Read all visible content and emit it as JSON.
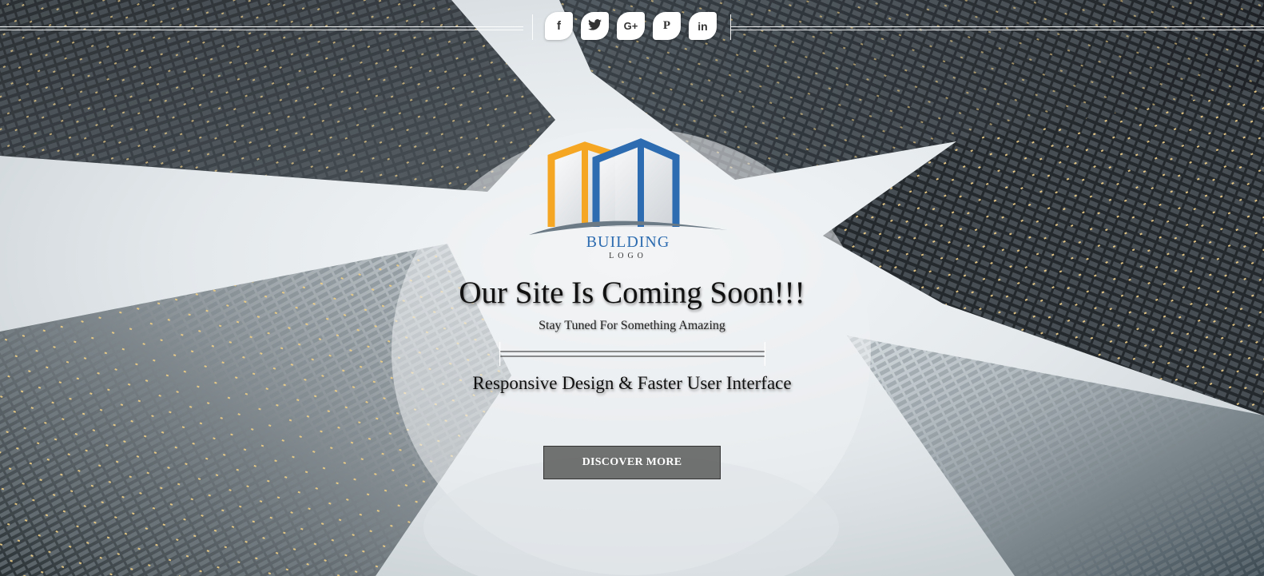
{
  "social": {
    "items": [
      {
        "icon": "facebook-icon",
        "glyph": "f"
      },
      {
        "icon": "twitter-icon",
        "glyph": "t"
      },
      {
        "icon": "google-plus-icon",
        "glyph": "G+"
      },
      {
        "icon": "pinterest-icon",
        "glyph": "P"
      },
      {
        "icon": "linkedin-icon",
        "glyph": "in"
      }
    ]
  },
  "logo": {
    "word1": "BUILDING",
    "word2": "LOGO",
    "colors": {
      "orange": "#f5a623",
      "blue": "#2d6cb0",
      "gray": "#6c7a86"
    }
  },
  "hero": {
    "title": "Our Site Is Coming Soon!!!",
    "tagline": "Stay Tuned For Something Amazing",
    "subtitle": "Responsive Design & Faster User Interface",
    "button_label": "DISCOVER MORE"
  }
}
